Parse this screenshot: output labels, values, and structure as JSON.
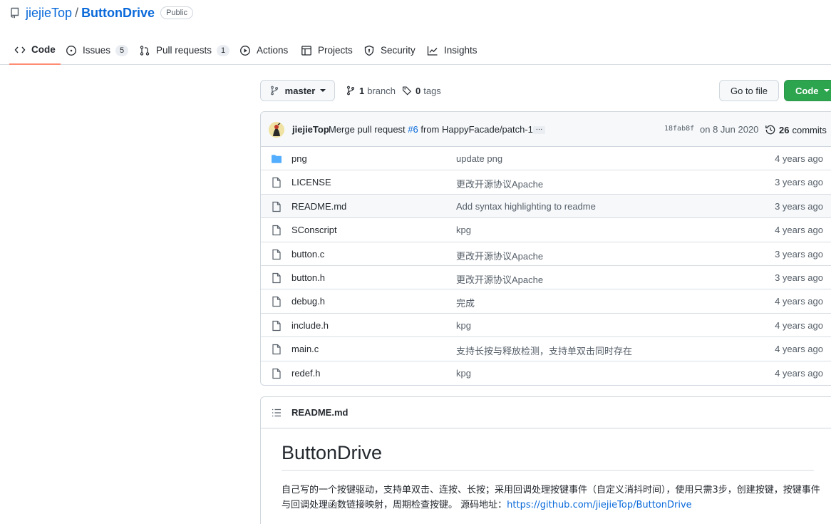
{
  "repo": {
    "owner": "jiejieTop",
    "separator": "/",
    "name": "ButtonDrive",
    "visibility": "Public"
  },
  "tabs": [
    {
      "label": "Code",
      "icon": "code-icon",
      "active": true
    },
    {
      "label": "Issues",
      "icon": "issue-icon",
      "count": "5"
    },
    {
      "label": "Pull requests",
      "icon": "pull-request-icon",
      "count": "1"
    },
    {
      "label": "Actions",
      "icon": "play-icon"
    },
    {
      "label": "Projects",
      "icon": "table-icon"
    },
    {
      "label": "Security",
      "icon": "shield-icon"
    },
    {
      "label": "Insights",
      "icon": "graph-icon"
    }
  ],
  "toolbar": {
    "branch": "master",
    "branch_count": "1",
    "branch_label": "branch",
    "tag_count": "0",
    "tag_label": "tags",
    "go_to_file": "Go to file",
    "code_button": "Code",
    "code_button_color": "#2da44e"
  },
  "commit": {
    "author": "jiejieTop",
    "message_pre": "Merge pull request",
    "pr": "#6",
    "message_post": "from HappyFacade/patch-1",
    "sha": "18fab8f",
    "date": "on 8 Jun 2020",
    "count": "26",
    "count_label": "commits"
  },
  "files": [
    {
      "name": "png",
      "type": "folder",
      "message": "update png",
      "age": "4 years ago"
    },
    {
      "name": "LICENSE",
      "type": "file",
      "message": "更改开源协议Apache",
      "age": "3 years ago"
    },
    {
      "name": "README.md",
      "type": "file",
      "message": "Add syntax highlighting to readme",
      "age": "3 years ago"
    },
    {
      "name": "SConscript",
      "type": "file",
      "message": "kpg",
      "age": "4 years ago"
    },
    {
      "name": "button.c",
      "type": "file",
      "message": "更改开源协议Apache",
      "age": "3 years ago"
    },
    {
      "name": "button.h",
      "type": "file",
      "message": "更改开源协议Apache",
      "age": "3 years ago"
    },
    {
      "name": "debug.h",
      "type": "file",
      "message": "完成",
      "age": "4 years ago"
    },
    {
      "name": "include.h",
      "type": "file",
      "message": "kpg",
      "age": "4 years ago"
    },
    {
      "name": "main.c",
      "type": "file",
      "message": "支持长按与释放检测，支持单双击同时存在",
      "age": "4 years ago"
    },
    {
      "name": "redef.h",
      "type": "file",
      "message": "kpg",
      "age": "4 years ago"
    }
  ],
  "readme": {
    "filename": "README.md",
    "title": "ButtonDrive",
    "body": "自己写的一个按键驱动，支持单双击、连按、长按；采用回调处理按键事件（自定义消抖时间），使用只需3步，创建按键，按键事件与回调处理函数链接映射，周期检查按键。 源码地址：",
    "link": "https://github.com/jiejieTop/ButtonDrive"
  }
}
